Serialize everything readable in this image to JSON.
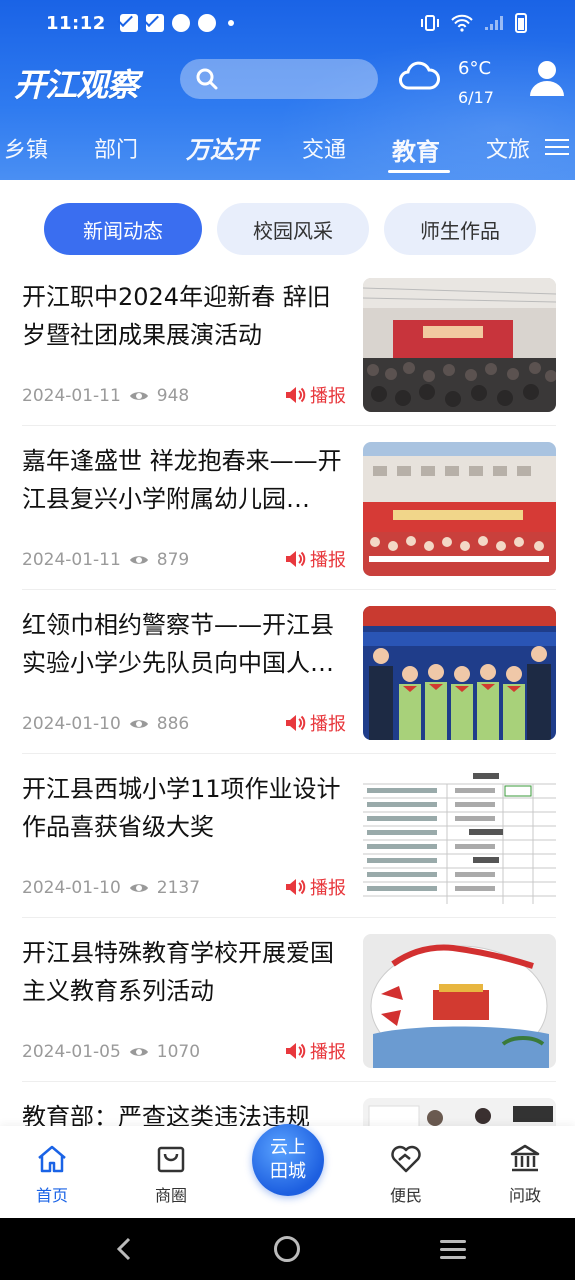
{
  "status_bar": {
    "time": "11:12"
  },
  "header": {
    "logo": "开江观察",
    "weather": {
      "temperature": "6°C",
      "date": "6/17",
      "icon": "cloud-icon"
    },
    "search": {
      "placeholder": ""
    }
  },
  "nav_tabs": [
    {
      "label": "乡镇"
    },
    {
      "label": "部门"
    },
    {
      "label": "万达开"
    },
    {
      "label": "交通"
    },
    {
      "label": "教育",
      "active": true
    },
    {
      "label": "文旅"
    }
  ],
  "sub_tabs": [
    {
      "label": "新闻动态",
      "active": true
    },
    {
      "label": "校园风采"
    },
    {
      "label": "师生作品"
    }
  ],
  "report_label": "播报",
  "news": [
    {
      "title": "开江职中2024年迎新春 辞旧岁暨社团成果展演活动",
      "date": "2024-01-11",
      "views": "948"
    },
    {
      "title": "嘉年逢盛世 祥龙抱春来——开江县复兴小学附属幼儿园…",
      "date": "2024-01-11",
      "views": "879"
    },
    {
      "title": "红领巾相约警察节——开江县实验小学少先队员向中国人民警察致敬",
      "date": "2024-01-10",
      "views": "886"
    },
    {
      "title": "开江县西城小学11项作业设计作品喜获省级大奖",
      "date": "2024-01-10",
      "views": "2137"
    },
    {
      "title": "开江县特殊教育学校开展爱国主义教育系列活动",
      "date": "2024-01-05",
      "views": "1070"
    },
    {
      "title": "教育部：严查这类违法违规",
      "date": "",
      "views": ""
    }
  ],
  "bottom_tabs": [
    {
      "label": "首页",
      "icon": "home-icon",
      "active": true
    },
    {
      "label": "商圈",
      "icon": "shop-icon"
    },
    {
      "label": "便民",
      "icon": "heart-hand-icon"
    },
    {
      "label": "问政",
      "icon": "government-icon"
    }
  ],
  "center_button": {
    "line1": "云上",
    "line2": "田城"
  },
  "colors": {
    "brand": "#1a63e6",
    "report": "#e8383d",
    "pill_active": "#3a6ef0"
  }
}
